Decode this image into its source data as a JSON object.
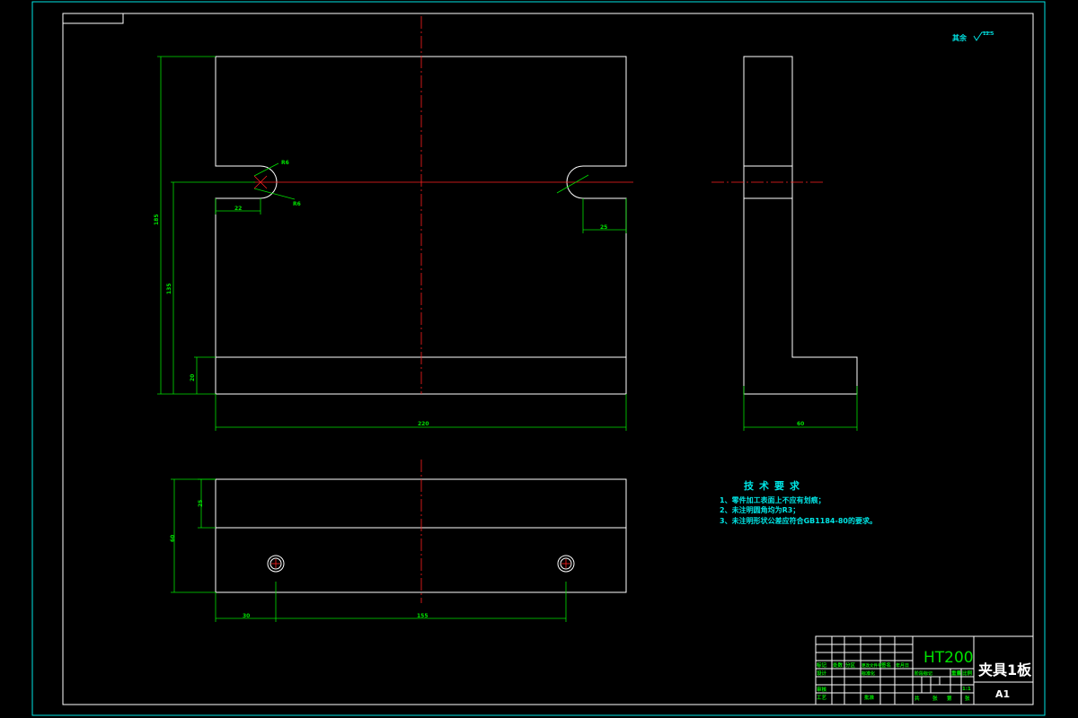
{
  "dimensions": {
    "upper_slot_left": "22",
    "slot_radius_upper": "R6",
    "slot_radius_lower": "R6",
    "slot_right": "25",
    "height_overall": "185",
    "height_to_slot": "135",
    "height_base": "20",
    "width_overall": "220",
    "side_width": "60",
    "bottom_height_step": "25",
    "bottom_height_overall": "60",
    "hole_offset": "30",
    "hole_spacing": "155"
  },
  "surface_finish": {
    "label": "其余",
    "value": "12.5"
  },
  "technical_requirements": {
    "heading": "技术要求",
    "items": [
      "1、零件加工表面上不应有划痕；",
      "2、未注明圆角均为R3；",
      "3、未注明形状公差应符合GB1184-80的要求。"
    ]
  },
  "title_block": {
    "material": "HT200",
    "part_name": "夹具1板",
    "sheet_size": "A1",
    "scale": "1:1",
    "labels": {
      "mark": "标记",
      "count": "处数",
      "zone": "分区",
      "change_doc": "更改文件号",
      "signature": "签名",
      "date": "年月日",
      "design": "设计",
      "check": "审核",
      "process": "工艺",
      "standardize": "标准化",
      "approve": "批准",
      "stage_mark": "阶段标记",
      "weight": "重量",
      "ratio": "比例",
      "total": "共",
      "sheets": "张",
      "page": "第",
      "page_sheets": "张"
    }
  }
}
